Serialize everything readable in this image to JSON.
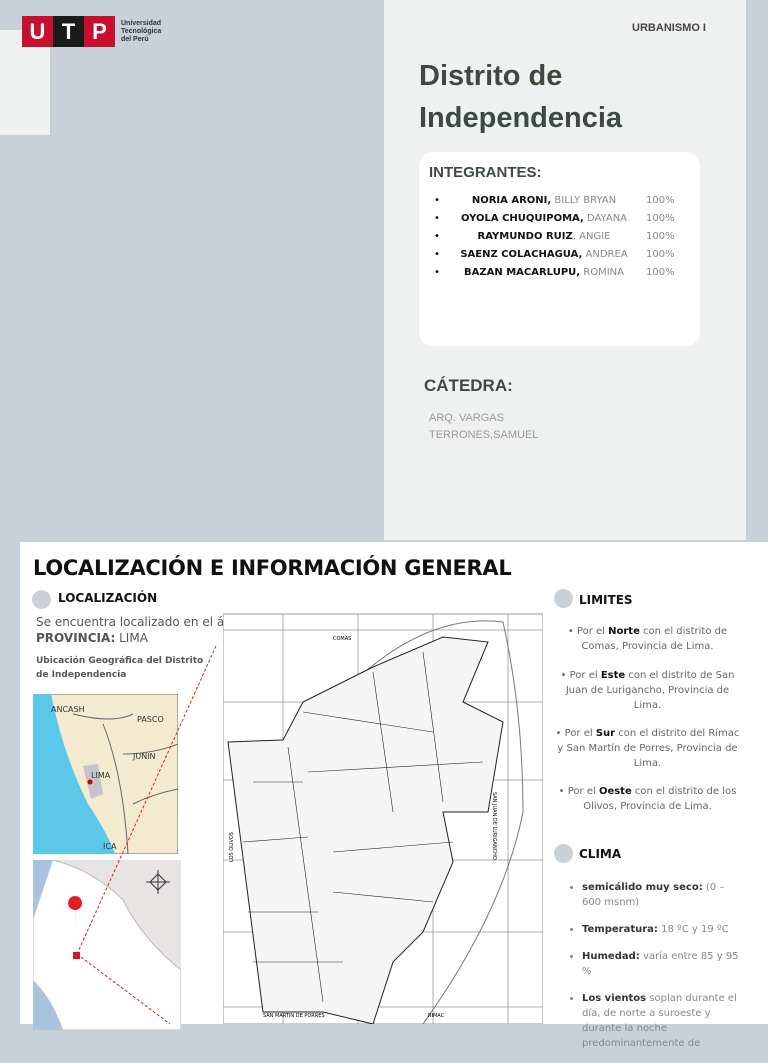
{
  "logo": {
    "letters": [
      "U",
      "T",
      "P"
    ],
    "text": [
      "Universidad",
      "Tecnológica",
      "del Perú"
    ]
  },
  "course": "URBANISMO I",
  "title_lines": [
    "Distrito de",
    "Independencia"
  ],
  "integrantes": {
    "heading": "INTEGRANTES:",
    "members": [
      {
        "surname": "NORIA ARONI,",
        "name": " BILLY BRYAN",
        "pct": "100%"
      },
      {
        "surname": "OYOLA CHUQUIPOMA,",
        "name": " DAYANA",
        "pct": "100%"
      },
      {
        "surname": "RAYMUNDO RUIZ",
        "name": ", ANGIE",
        "pct": "100%"
      },
      {
        "surname": "SAENZ COLACHAGUA,",
        "name": " ANDREA",
        "pct": "100%"
      },
      {
        "surname": "BAZAN MACARLUPU,",
        "name": " ROMINA",
        "pct": "100%"
      }
    ]
  },
  "catedra": {
    "heading": "CÁTEDRA:",
    "lines": [
      "ARQ. VARGAS",
      "TERRONES,SAMUEL"
    ]
  },
  "slide2": {
    "title": "LOCALIZACIÓN E INFORMACIÓN GENERAL",
    "localizacion": {
      "heading": "LOCALIZACIÓN",
      "desc": "Se encuentra localizado en el área norte de Lima Metropolitana",
      "prov_label": "PROVINCIA:",
      "prov_value": " LIMA",
      "caption": "Ubicación Geográfica del Distrito de Independencia"
    },
    "map_labels": {
      "ancash": "ANCASH",
      "pasco": "PASCO",
      "junin": "JUNIN",
      "lima": "LIMA",
      "ica": "ICA",
      "comas": "COMAS",
      "smp": "SAN MARTIN DE PORRES",
      "rimac": "RIMAC",
      "sjl": "SAN JUAN DE LURIGANCHO",
      "olivos": "LOS OLIVOS"
    },
    "limites": {
      "heading": "LIMITES",
      "items": [
        {
          "pre": "• Por el ",
          "bold": "Norte",
          "post": " con el distrito de Comas, Provincia de Lima."
        },
        {
          "pre": "• Por el ",
          "bold": "Este",
          "post": " con el distrito de San Juan de Lurigancho, Provincia de Lima."
        },
        {
          "pre": "• Por el ",
          "bold": "Sur",
          "post": " con el distrito del Rímac y San Martín de Porres, Provincia de Lima."
        },
        {
          "pre": "• Por el ",
          "bold": "Oeste",
          "post": " con el distrito de los Olivos, Provincia de Lima."
        }
      ]
    },
    "clima": {
      "heading": "CLIMA",
      "items": [
        {
          "bold": "semicálido muy seco:",
          "text": " (0 – 600 msnm)"
        },
        {
          "bold": "Temperatura:",
          "text": " 18 ºC y 19 ºC"
        },
        {
          "bold": "Humedad:",
          "text": " varía entre 85 y 95 %"
        },
        {
          "bold": "Los vientos",
          "text": " soplan durante el día, de norte a suroeste y durante la noche predominantemente de"
        }
      ]
    }
  },
  "colors": {
    "utp_red": "#c8102e",
    "utp_black": "#1a1a1a",
    "title": "#3f4a3f",
    "bg_gray": "#c8d0da"
  }
}
